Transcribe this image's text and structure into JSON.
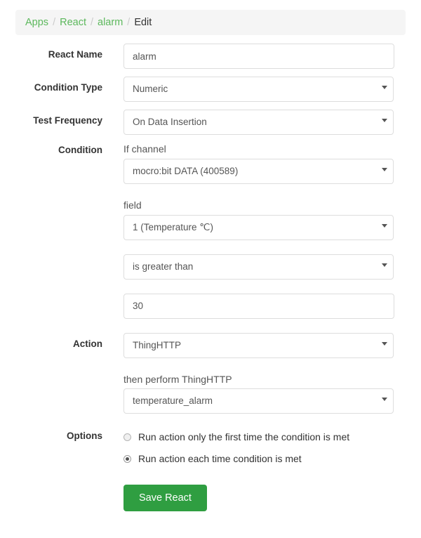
{
  "breadcrumb": {
    "items": [
      {
        "label": "Apps",
        "active": false
      },
      {
        "label": "React",
        "active": false
      },
      {
        "label": "alarm",
        "active": false
      },
      {
        "label": "Edit",
        "active": true
      }
    ],
    "separator": "/"
  },
  "form": {
    "react_name": {
      "label": "React Name",
      "value": "alarm",
      "placeholder": ""
    },
    "condition_type": {
      "label": "Condition Type",
      "value": "Numeric"
    },
    "test_frequency": {
      "label": "Test Frequency",
      "value": "On Data Insertion"
    },
    "condition": {
      "label": "Condition",
      "channel_sublabel": "If channel",
      "channel_value": "mocro:bit DATA (400589)",
      "field_sublabel": "field",
      "field_value": "1 (Temperature ℃)",
      "comparator_value": "is greater than",
      "threshold_value": "30",
      "threshold_placeholder": ""
    },
    "action": {
      "label": "Action",
      "value": "ThingHTTP",
      "perform_sublabel": "then perform ThingHTTP",
      "perform_value": "temperature_alarm"
    },
    "options": {
      "label": "Options",
      "choices": [
        {
          "text": "Run action only the first time the condition is met",
          "selected": false
        },
        {
          "text": "Run action each time condition is met",
          "selected": true
        }
      ]
    },
    "save": {
      "label": "Save React"
    }
  },
  "colors": {
    "accent_green": "#2f9e41",
    "link_green": "#5cb85c",
    "breadcrumb_bg": "#f5f5f5",
    "border": "#dddddd"
  }
}
